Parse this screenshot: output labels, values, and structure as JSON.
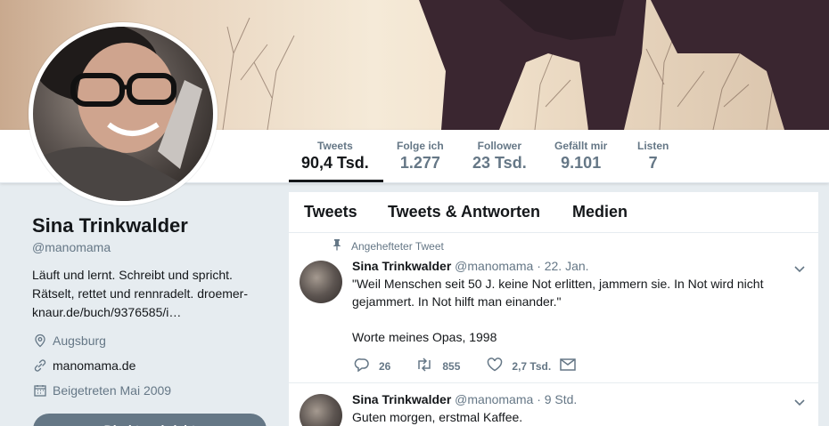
{
  "nav": {
    "stats": [
      {
        "label": "Tweets",
        "value": "90,4 Tsd."
      },
      {
        "label": "Folge ich",
        "value": "1.277"
      },
      {
        "label": "Follower",
        "value": "23 Tsd."
      },
      {
        "label": "Gefällt mir",
        "value": "9.101"
      },
      {
        "label": "Listen",
        "value": "7"
      }
    ]
  },
  "profile": {
    "name": "Sina Trinkwalder",
    "handle": "@manomama",
    "bio": "Läuft und lernt. Schreibt und spricht. Rätselt, rettet und rennradelt. droemer-knaur.de/buch/9376585/i…",
    "location": "Augsburg",
    "website": "manomama.de",
    "joined": "Beigetreten Mai 2009",
    "button_label": "Direktnachricht"
  },
  "timeline": {
    "tabs": [
      "Tweets",
      "Tweets & Antworten",
      "Medien"
    ],
    "tweets": [
      {
        "context": "Angehefteter Tweet",
        "author": "Sina Trinkwalder",
        "handle": "@manomama",
        "time": "· 22. Jan.",
        "text": "\"Weil Menschen seit 50 J. keine Not erlitten, jammern sie. In Not wird nicht gejammert. In Not hilft man einander.\"\n\nWorte meines Opas, 1998",
        "replies": "26",
        "retweets": "855",
        "likes": "2,7 Tsd."
      },
      {
        "author": "Sina Trinkwalder",
        "handle": "@manomama",
        "time": "· 9 Std.",
        "text": "Guten morgen, erstmal Kaffee."
      }
    ]
  },
  "colors": {
    "accent": "#14171a",
    "secondary_text": "#657786",
    "background": "#e6ecf0"
  },
  "icons": [
    "pin-icon",
    "location-icon",
    "link-icon",
    "calendar-icon",
    "reply-icon",
    "retweet-icon",
    "like-icon",
    "dm-icon",
    "chevron-down-icon"
  ]
}
